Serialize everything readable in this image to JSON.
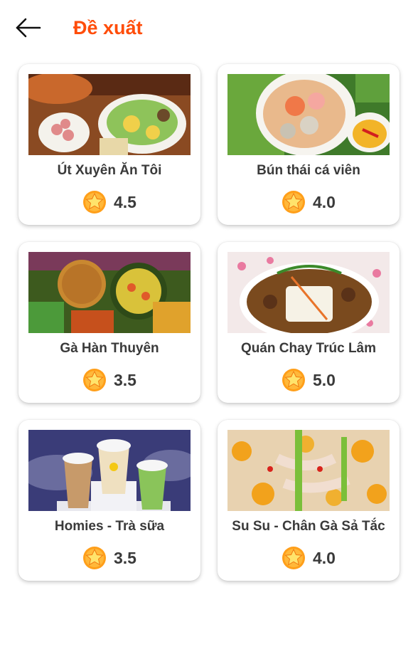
{
  "header": {
    "title": "Đề xuất",
    "back_icon": "arrow-left-icon"
  },
  "colors": {
    "accent": "#ff4d0a",
    "text": "#3a3a3a",
    "star": "#ff9f1a"
  },
  "items": [
    {
      "name": "Út Xuyên Ăn Tôi",
      "rating": "4.5"
    },
    {
      "name": "Bún thái cá viên",
      "rating": "4.0"
    },
    {
      "name": "Gà Hàn Thuyên",
      "rating": "3.5"
    },
    {
      "name": "Quán Chay Trúc Lâm",
      "rating": "5.0"
    },
    {
      "name": "Homies - Trà sữa",
      "rating": "3.5"
    },
    {
      "name": "Su Su - Chân Gà Sả Tắc",
      "rating": "4.0"
    }
  ]
}
